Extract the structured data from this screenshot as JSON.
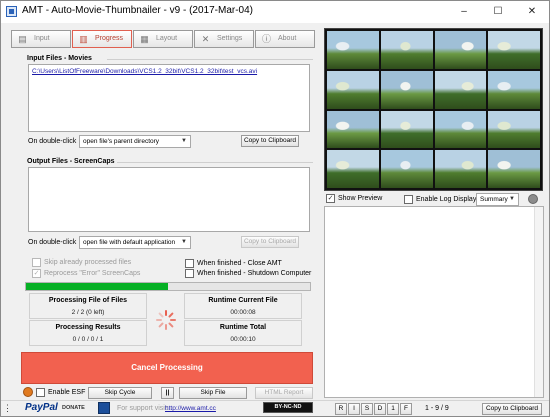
{
  "window": {
    "title": "AMT - Auto-Movie-Thumbnailer - v9 - (2017-Mar-04)",
    "minimize": "–",
    "maximize": "☐",
    "close": "✕"
  },
  "tabs": [
    {
      "label": "Input",
      "icon": "input-icon",
      "active": false
    },
    {
      "label": "Progress",
      "icon": "progress-icon",
      "active": true
    },
    {
      "label": "Layout",
      "icon": "layout-icon",
      "active": false
    },
    {
      "label": "Settings",
      "icon": "settings-icon",
      "active": false
    },
    {
      "label": "About",
      "icon": "info-icon",
      "active": false
    }
  ],
  "input_files": {
    "title": "Input Files - Movies",
    "items": [
      "C:\\Users\\ListOfFreeware\\Downloads\\VCS1.2_32bit\\VCS1.2_32bit\\test_vcs.avi"
    ],
    "double_click_label": "On double-click",
    "double_click_value": "open file's parent directory",
    "copy_label": "Copy to Clipboard"
  },
  "output_files": {
    "title": "Output Files - ScreenCaps",
    "items": [],
    "double_click_label": "On double-click",
    "double_click_value": "open file with default application",
    "copy_label": "Copy to Clipboard"
  },
  "options": {
    "skip_processed": "Skip already processed files",
    "skip_processed_checked": false,
    "reprocess_error": "Reprocess \"Error\" ScreenCaps",
    "reprocess_error_checked": true,
    "close_amt": "When finished - Close AMT",
    "close_amt_checked": false,
    "shutdown": "When finished - Shutdown Computer",
    "shutdown_checked": false
  },
  "progress": {
    "fraction": 0.5
  },
  "stats": {
    "processing_file_label": "Processing File of Files",
    "processing_file_value": "2 / 2 (0 left)",
    "processing_results_label": "Processing Results",
    "processing_results_value": "0 / 0 / 0 / 1",
    "runtime_current_label": "Runtime Current File",
    "runtime_current_value": "00:00:08",
    "runtime_total_label": "Runtime Total",
    "runtime_total_value": "00:00:10"
  },
  "cancel_label": "Cancel Processing",
  "bottom_controls": {
    "enable_esf": "Enable ESF",
    "skip_cycle": "Skip Cycle",
    "pause": "||",
    "skip_file": "Skip File",
    "html_report": "HTML Report"
  },
  "footer": {
    "paypal": "PayPal",
    "donate": "DONATE",
    "support_text": "For support visit:",
    "support_link": "http://www.amt.cc",
    "license": "BY-NC-ND",
    "buttons": [
      "R",
      "I",
      "S",
      "D",
      "1",
      "F"
    ],
    "counter": "1 - 9 / 9",
    "copy_label": "Copy to Clipboard"
  },
  "preview": {
    "show_preview": "Show Preview",
    "show_preview_checked": true,
    "enable_log": "Enable Log Display",
    "enable_log_checked": false,
    "log_mode": "Summary",
    "thumb_rows": 4,
    "thumb_cols": 4
  },
  "colors": {
    "accent_red": "#f2614f",
    "progress_green": "#06b025",
    "link_blue": "#1a1aa8"
  }
}
